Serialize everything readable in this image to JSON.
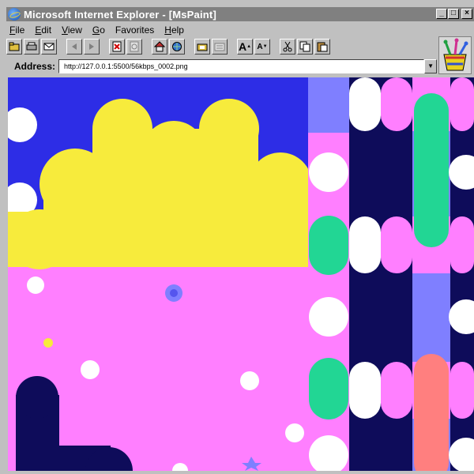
{
  "window": {
    "title": "Microsoft Internet Explorer - [MsPaint]",
    "buttons": {
      "minimize": "_",
      "maximize": "□",
      "close": "×"
    }
  },
  "menu": {
    "items": [
      {
        "accel": "F",
        "rest": "ile"
      },
      {
        "accel": "E",
        "rest": "dit"
      },
      {
        "accel": "V",
        "rest": "iew"
      },
      {
        "accel": "G",
        "rest": "o"
      },
      {
        "accel": "",
        "rest": "Favorites"
      },
      {
        "accel": "H",
        "rest": "elp"
      }
    ]
  },
  "toolbar": {
    "font_large": "A",
    "font_small": "A"
  },
  "address": {
    "label": "Address:",
    "url": "http://127.0.0.1:5500/56kbps_0002.png",
    "dropdown": "▼"
  },
  "colors": {
    "blue": "#2d2de6",
    "yellow": "#f7eb3c",
    "pink": "#ff7fff",
    "navy": "#0e0c5a",
    "teal": "#22d694",
    "periwinkle": "#7f7fff",
    "salmon": "#ff7f7f",
    "white": "#ffffff"
  }
}
